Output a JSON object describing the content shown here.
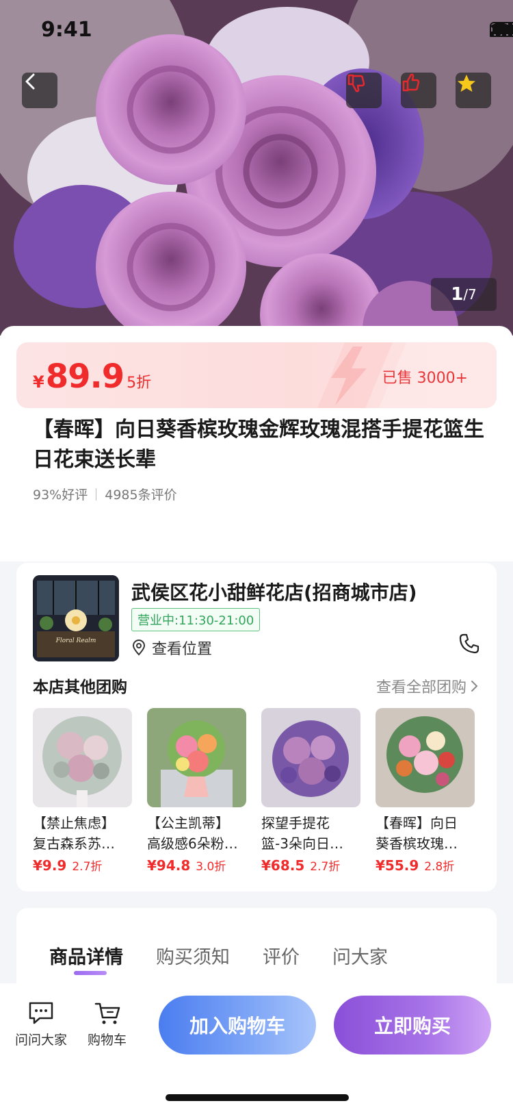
{
  "status_bar": {
    "time": "9:41"
  },
  "hero": {
    "pager_current": "1",
    "pager_total": "/7",
    "icons": [
      "back-icon",
      "thumbs-down-icon",
      "thumbs-up-icon",
      "star-icon"
    ]
  },
  "price": {
    "currency": "¥",
    "value": "89.9",
    "discount": "5折",
    "sold": "已售 3000+"
  },
  "product": {
    "title": "【春晖】向日葵香槟玫瑰金辉玫瑰混搭手提花篮生日花束送长辈",
    "good_rate": "93%好评",
    "review_count": "4985条评价"
  },
  "store": {
    "name": "武侯区花小甜鲜花店(招商城市店)",
    "hours": "营业中:11:30-21:00",
    "location_label": "查看位置",
    "image_sign": "Floral Realm",
    "other_title": "本店其他团购",
    "view_all": "查看全部团购",
    "products": [
      {
        "line1": "【禁止焦虑】",
        "line2": "复古森系苏…",
        "price": "¥9.9",
        "discount": "2.7折"
      },
      {
        "line1": "【公主凯蒂】",
        "line2": "高级感6朵粉…",
        "price": "¥94.8",
        "discount": "3.0折"
      },
      {
        "line1": "探望手提花",
        "line2": "篮-3朵向日…",
        "price": "¥68.5",
        "discount": "2.7折"
      },
      {
        "line1": "【春晖】向日",
        "line2": "葵香槟玫瑰…",
        "price": "¥55.9",
        "discount": "2.8折"
      }
    ]
  },
  "tabs": [
    "商品详情",
    "购买须知",
    "评价",
    "问大家"
  ],
  "bottom_bar": {
    "ask_label": "问问大家",
    "cart_label": "购物车",
    "add_to_cart": "加入购物车",
    "buy_now": "立即购买"
  },
  "colors": {
    "price_red": "#f02b2b",
    "open_green": "#2fa65a",
    "cart_blue": "#4b7df0",
    "buy_purple": "#8a4fd8"
  }
}
